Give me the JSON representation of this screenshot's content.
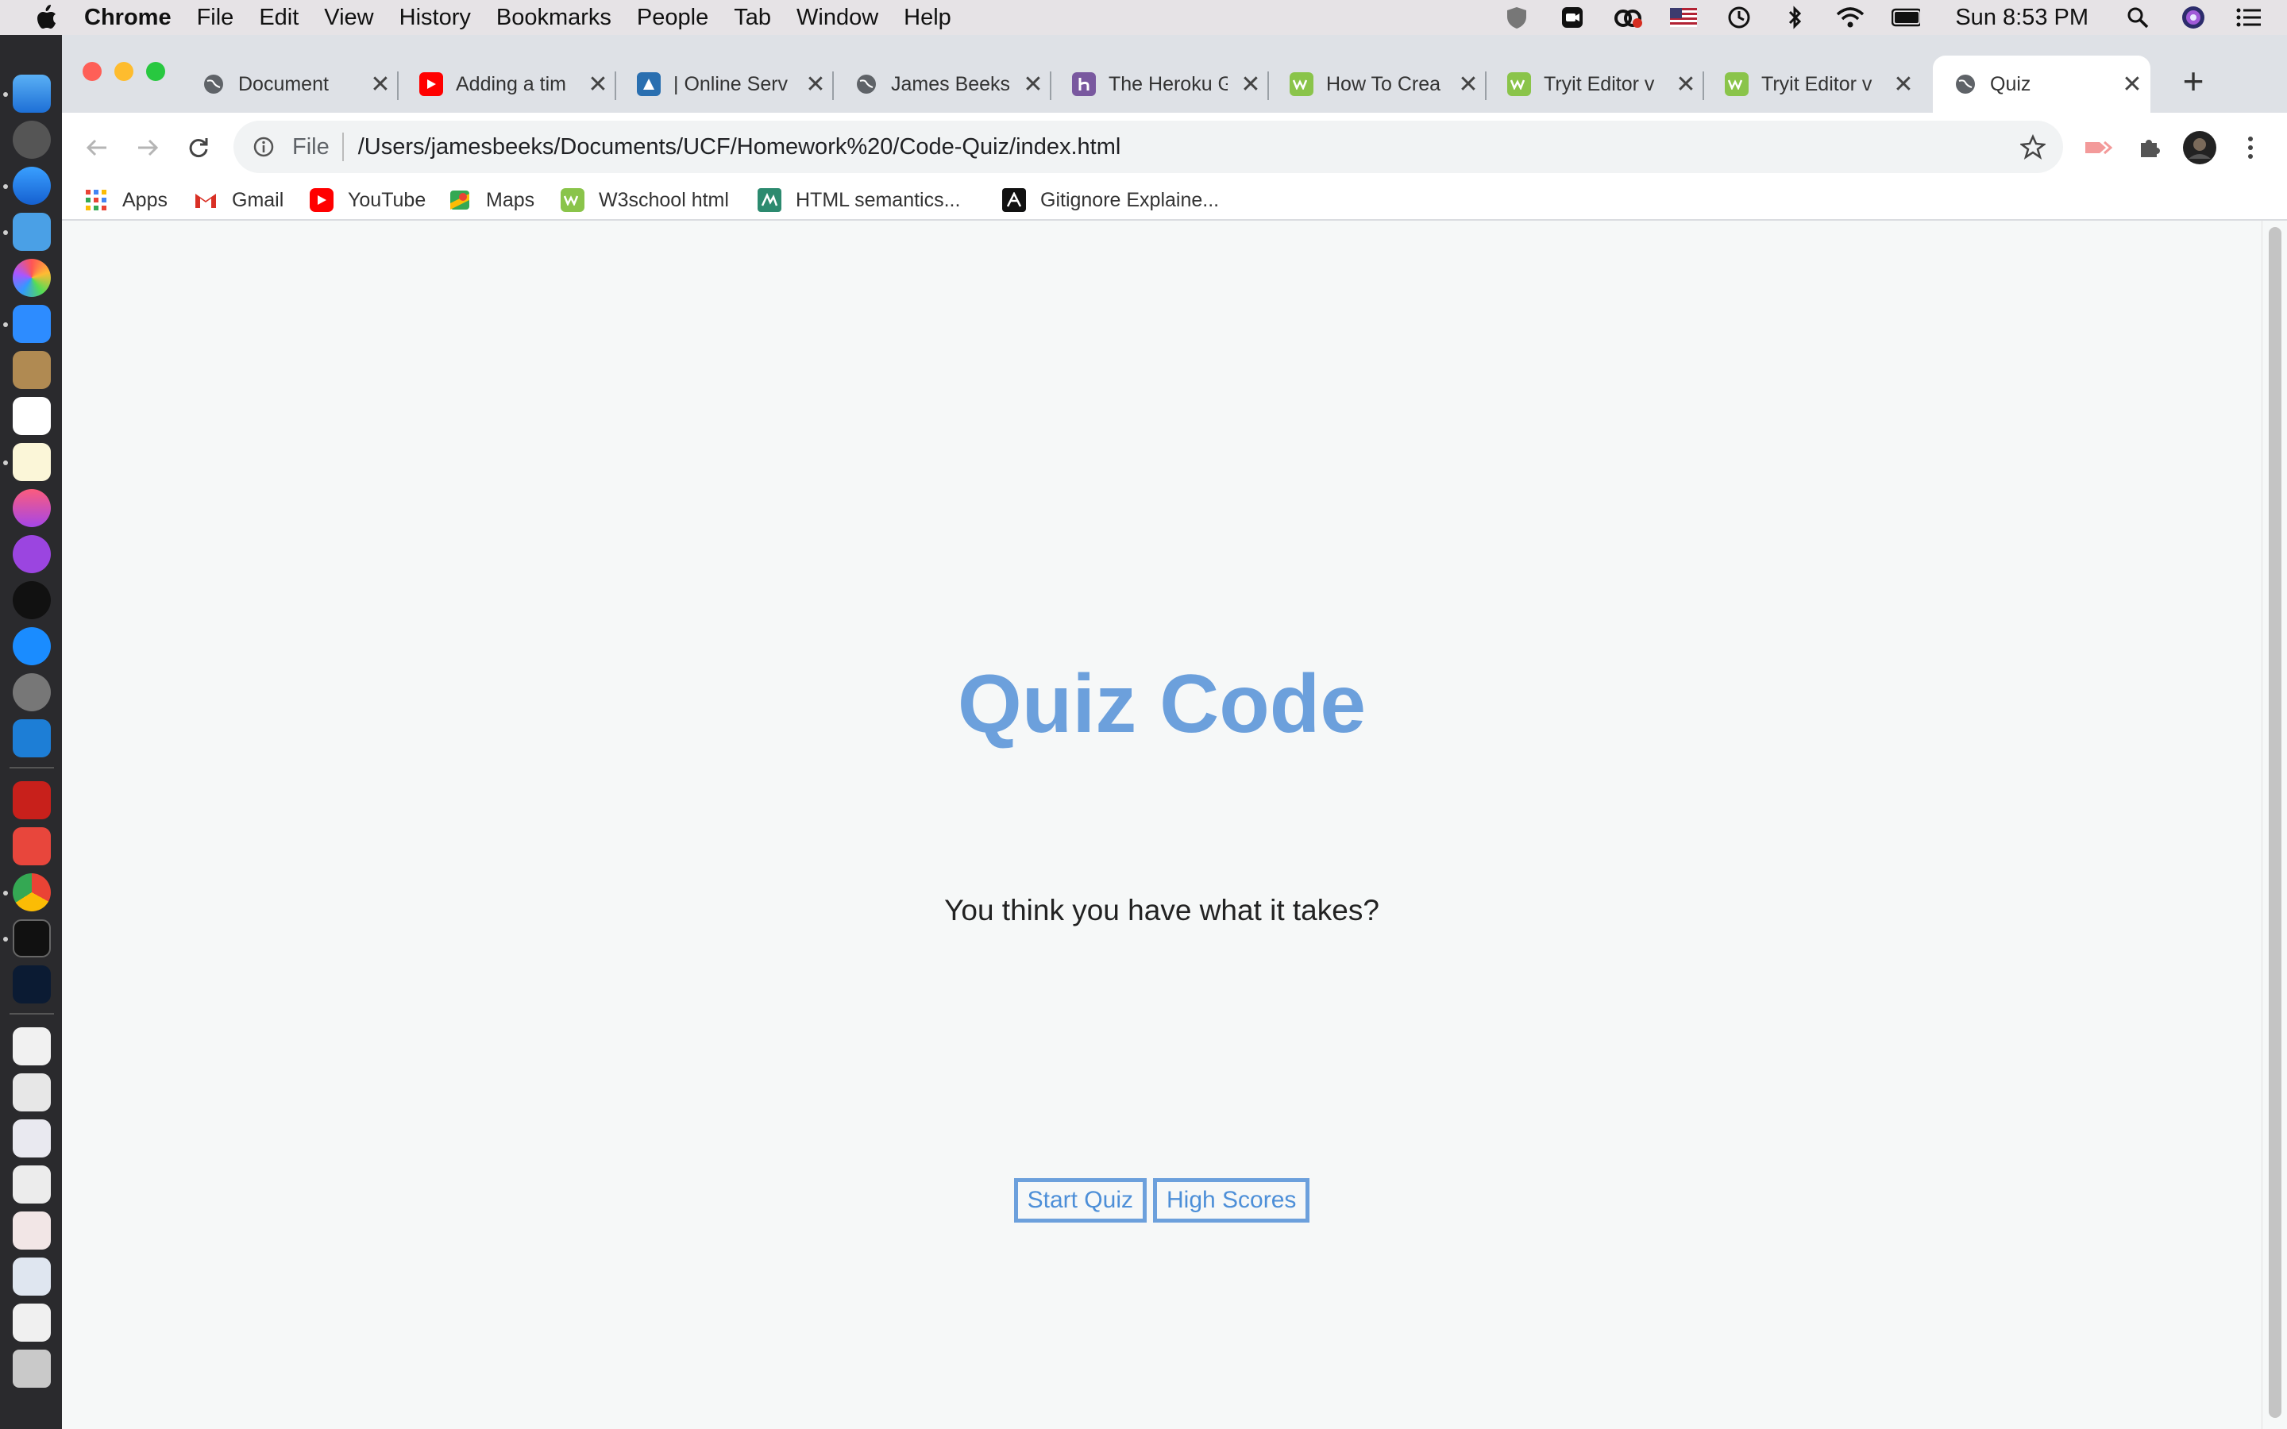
{
  "menubar": {
    "app_name": "Chrome",
    "items": [
      "File",
      "Edit",
      "View",
      "History",
      "Bookmarks",
      "People",
      "Tab",
      "Window",
      "Help"
    ],
    "clock": "Sun 8:53 PM"
  },
  "tabs": [
    {
      "title": "Document",
      "icon": "globe-icon",
      "color": "#5f6368"
    },
    {
      "title": "Adding a tim",
      "icon": "youtube-icon",
      "color": "#ff0000"
    },
    {
      "title": "| Online Serv",
      "icon": "azure-icon",
      "color": "#2a6fb0"
    },
    {
      "title": "James Beeks",
      "icon": "globe-icon",
      "color": "#5f6368"
    },
    {
      "title": "The Heroku G",
      "icon": "heroku-icon",
      "color": "#79589f"
    },
    {
      "title": "How To Crea",
      "icon": "w3schools-icon",
      "color": "#8ac44a"
    },
    {
      "title": "Tryit Editor v",
      "icon": "w3schools-icon",
      "color": "#8ac44a"
    },
    {
      "title": "Tryit Editor v",
      "icon": "w3schools-icon",
      "color": "#8ac44a"
    },
    {
      "title": "Quiz",
      "icon": "globe-icon",
      "color": "#5f6368",
      "active": true
    }
  ],
  "omnibox": {
    "scheme": "File",
    "url": "/Users/jamesbeeks/Documents/UCF/Homework%20/Code-Quiz/index.html"
  },
  "bookmarks": [
    {
      "label": "Apps",
      "icon": "apps-grid-icon",
      "color": "#e94335"
    },
    {
      "label": "Gmail",
      "icon": "gmail-icon",
      "color": "#d93025"
    },
    {
      "label": "YouTube",
      "icon": "youtube-icon",
      "color": "#ff0000"
    },
    {
      "label": "Maps",
      "icon": "maps-icon",
      "color": "#34a853"
    },
    {
      "label": "W3school html",
      "icon": "w3schools-icon",
      "color": "#8ac44a"
    },
    {
      "label": "HTML semantics...",
      "icon": "mdn-icon",
      "color": "#2c8a6f"
    },
    {
      "label": "Gitignore Explaine...",
      "icon": "gitignore-icon",
      "color": "#111111"
    }
  ],
  "page": {
    "title": "Quiz Code",
    "tagline": "You think you have what it takes?",
    "start_label": "Start Quiz",
    "scores_label": "High Scores",
    "accent": "#6ca0dc"
  }
}
